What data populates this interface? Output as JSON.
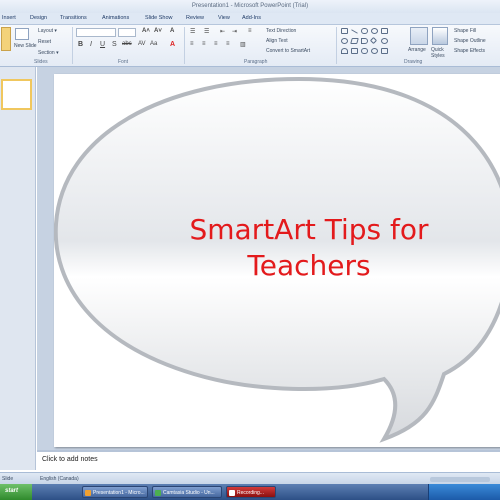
{
  "window": {
    "title": "Presentation1 - Microsoft PowerPoint (Trial)"
  },
  "ribbon": {
    "tabs": [
      "Insert",
      "Design",
      "Transitions",
      "Animations",
      "Slide Show",
      "Review",
      "View",
      "Add-Ins"
    ],
    "slides_group": {
      "new_slide_label": "New Slide",
      "layout_label": "Layout",
      "reset_label": "Reset",
      "section_label": "Section",
      "group_name": "Slides"
    },
    "font_group": {
      "group_name": "Font"
    },
    "paragraph_group": {
      "text_direction_label": "Text Direction",
      "align_text_label": "Align Text",
      "convert_smartart_label": "Convert to SmartArt",
      "group_name": "Paragraph"
    },
    "drawing_group": {
      "arrange_label": "Arrange",
      "quick_styles_label": "Quick Styles",
      "shape_fill_label": "Shape Fill",
      "shape_outline_label": "Shape Outline",
      "shape_effects_label": "Shape Effects",
      "group_name": "Drawing"
    }
  },
  "slide": {
    "title": "SmartArt Tips for Teachers",
    "title_color": "#e31a1c"
  },
  "notes": {
    "placeholder": "Click to add notes"
  },
  "status": {
    "slide_label": "Slide",
    "language": "English (Canada)"
  },
  "taskbar": {
    "start_label": "start",
    "items": [
      {
        "label": "Presentation1 - Micro..."
      },
      {
        "label": "Camtasia Studio - Un..."
      },
      {
        "label": "Recording..."
      }
    ]
  }
}
